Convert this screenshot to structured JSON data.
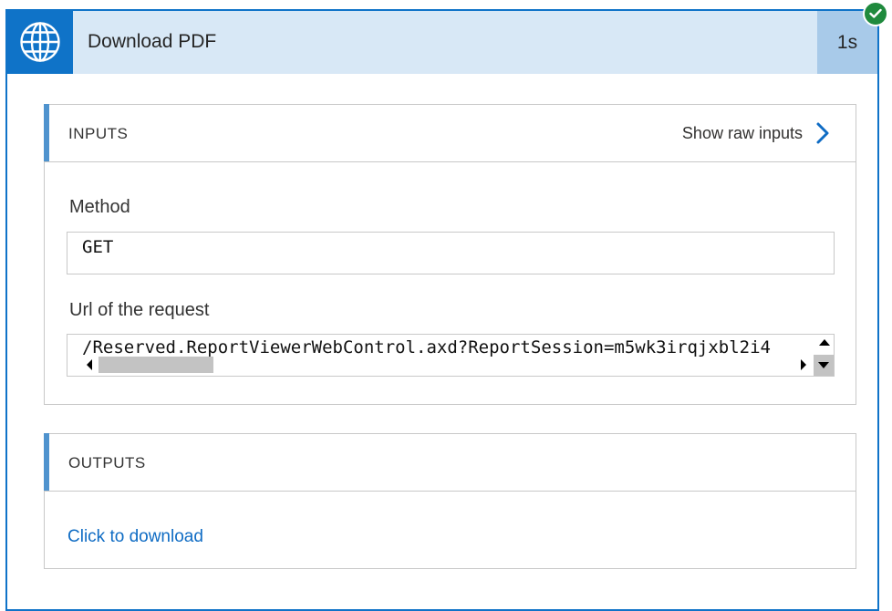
{
  "action": {
    "title": "Download PDF",
    "duration": "1s",
    "status": "Succeeded",
    "colors": {
      "accent": "#0f73c8",
      "header_bg": "#d8e8f6",
      "duration_bg": "#a8cae9",
      "success": "#1f8a3d",
      "link": "#0f6cc4"
    }
  },
  "inputs": {
    "title": "INPUTS",
    "raw_link_label": "Show raw inputs",
    "fields": [
      {
        "label": "Method",
        "value": "GET"
      },
      {
        "label": "Url of the request",
        "value": "/Reserved.ReportViewerWebControl.axd?ReportSession=m5wk3irqjxbl2i4"
      }
    ]
  },
  "outputs": {
    "title": "OUTPUTS",
    "link_label": "Click to download"
  },
  "icons": {
    "action_icon": "globe-icon",
    "status_icon": "check-icon",
    "raw_link_icon": "chevron-right-icon"
  }
}
